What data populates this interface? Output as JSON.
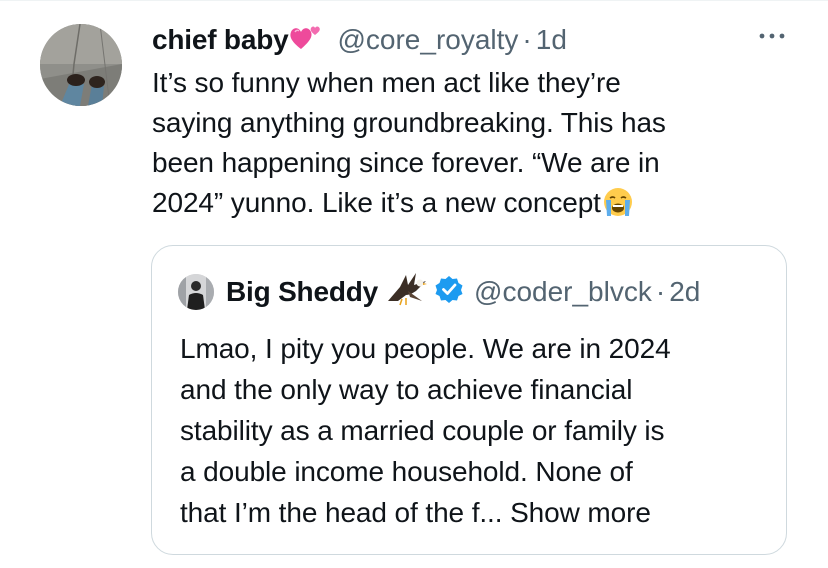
{
  "tweet": {
    "author_name": "chief baby",
    "author_handle": "@core_royalty",
    "separator": "·",
    "timestamp": "1d",
    "text_lines": [
      "It’s so funny when men act like they’re",
      "saying anything groundbreaking. This has",
      "been happening since forever. “We are in",
      "2024” yunno. Like it’s a new concept"
    ],
    "icons": {
      "name_emoji": "two-hearts-icon",
      "end_emoji": "crying-face-icon",
      "more": "more-dots-icon"
    }
  },
  "quote": {
    "author_name": "Big Sheddy",
    "author_handle": "@coder_blvck",
    "separator": "·",
    "timestamp": "2d",
    "text_lines": [
      "Lmao, I pity you people. We are in 2024",
      "and the only way to achieve financial",
      "stability as a married couple or family is",
      "a double income household. None of",
      "that I’m the head of the f..."
    ],
    "show_more": "Show more",
    "icons": {
      "name_emoji": "eagle-icon",
      "verified": "verified-badge-icon"
    }
  },
  "colors": {
    "text": "#0f1419",
    "secondary": "#536471",
    "border": "#cfd9de",
    "verified": "#1d9bf0",
    "heart": "#ee4a9b"
  }
}
